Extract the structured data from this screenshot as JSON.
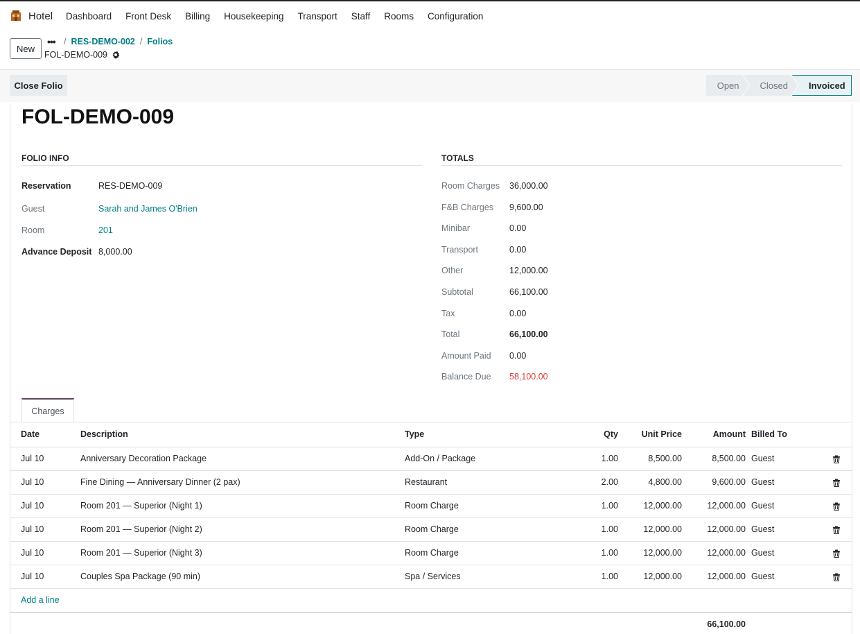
{
  "app": {
    "name": "Hotel",
    "menu": [
      "Dashboard",
      "Front Desk",
      "Billing",
      "Housekeeping",
      "Transport",
      "Staff",
      "Rooms",
      "Configuration"
    ]
  },
  "control": {
    "new_label": "New",
    "breadcrumb_dots": "•••",
    "breadcrumb": [
      "RES-DEMO-002",
      "Folios"
    ],
    "breadcrumb_sep": "/",
    "current": "FOL-DEMO-009"
  },
  "actions": {
    "close_folio": "Close Folio"
  },
  "statusbar": {
    "steps": [
      "Open",
      "Closed",
      "Invoiced"
    ],
    "active": "Invoiced"
  },
  "record": {
    "title": "FOL-DEMO-009"
  },
  "folio_info": {
    "heading": "FOLIO INFO",
    "reservation_label": "Reservation",
    "reservation": "RES-DEMO-009",
    "guest_label": "Guest",
    "guest": "Sarah and James O'Brien",
    "room_label": "Room",
    "room": "201",
    "advance_deposit_label": "Advance Deposit",
    "advance_deposit": "8,000.00"
  },
  "totals": {
    "heading": "TOTALS",
    "rows": [
      {
        "label": "Room Charges",
        "value": "36,000.00"
      },
      {
        "label": "F&B Charges",
        "value": "9,600.00"
      },
      {
        "label": "Minibar",
        "value": "0.00"
      },
      {
        "label": "Transport",
        "value": "0.00"
      },
      {
        "label": "Other",
        "value": "12,000.00"
      },
      {
        "label": "Subtotal",
        "value": "66,100.00"
      },
      {
        "label": "Tax",
        "value": "0.00"
      },
      {
        "label": "Total",
        "value": "66,100.00"
      },
      {
        "label": "Amount Paid",
        "value": "0.00"
      },
      {
        "label": "Balance Due",
        "value": "58,100.00"
      }
    ]
  },
  "charges": {
    "tab_label": "Charges",
    "columns": [
      "Date",
      "Description",
      "Type",
      "Qty",
      "Unit Price",
      "Amount",
      "Billed To"
    ],
    "rows": [
      [
        "Jul 10",
        "Anniversary Decoration Package",
        "Add-On / Package",
        "1.00",
        "8,500.00",
        "8,500.00",
        "Guest"
      ],
      [
        "Jul 10",
        "Fine Dining — Anniversary Dinner (2 pax)",
        "Restaurant",
        "2.00",
        "4,800.00",
        "9,600.00",
        "Guest"
      ],
      [
        "Jul 10",
        "Room 201 — Superior (Night 1)",
        "Room Charge",
        "1.00",
        "12,000.00",
        "12,000.00",
        "Guest"
      ],
      [
        "Jul 10",
        "Room 201 — Superior (Night 2)",
        "Room Charge",
        "1.00",
        "12,000.00",
        "12,000.00",
        "Guest"
      ],
      [
        "Jul 10",
        "Room 201 — Superior (Night 3)",
        "Room Charge",
        "1.00",
        "12,000.00",
        "12,000.00",
        "Guest"
      ],
      [
        "Jul 10",
        "Couples Spa Package (90 min)",
        "Spa / Services",
        "1.00",
        "12,000.00",
        "12,000.00",
        "Guest"
      ]
    ],
    "add_line": "Add a line",
    "footer_total": "66,100.00"
  },
  "colors": {
    "accent": "#017e84",
    "danger": "#d23f3a",
    "tab_top": "#5c4660"
  }
}
